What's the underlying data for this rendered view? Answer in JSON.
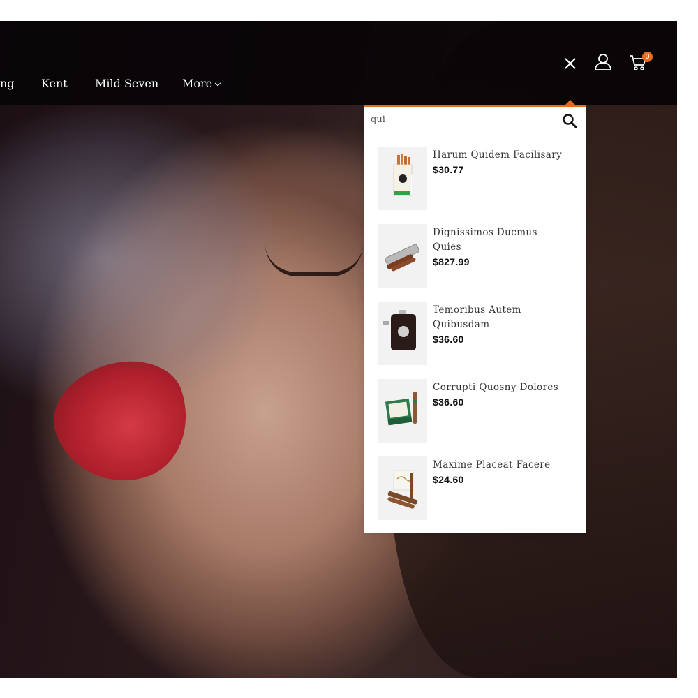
{
  "nav": {
    "items": [
      {
        "label": "ng"
      },
      {
        "label": "Kent"
      },
      {
        "label": "Mild Seven"
      }
    ],
    "more_label": "More",
    "cart_count": "0"
  },
  "search": {
    "value": "qui",
    "placeholder": "Search"
  },
  "results": [
    {
      "name": "Harum Quidem Facilisary",
      "price": "$30.77"
    },
    {
      "name": "Dignissimos Ducmus Quies",
      "price": "$827.99"
    },
    {
      "name": "Temoribus Autem Quibusdam",
      "price": "$36.60"
    },
    {
      "name": "Corrupti Quosny Dolores",
      "price": "$36.60"
    },
    {
      "name": "Maxime Placeat Facere",
      "price": "$24.60"
    }
  ],
  "colors": {
    "accent": "#ec6a1b",
    "nav_bg": "#060306",
    "dropdown_bg": "#ffffff"
  },
  "icons": {
    "close": "close-icon",
    "account": "user-icon",
    "cart": "cart-icon",
    "search": "search-icon"
  }
}
